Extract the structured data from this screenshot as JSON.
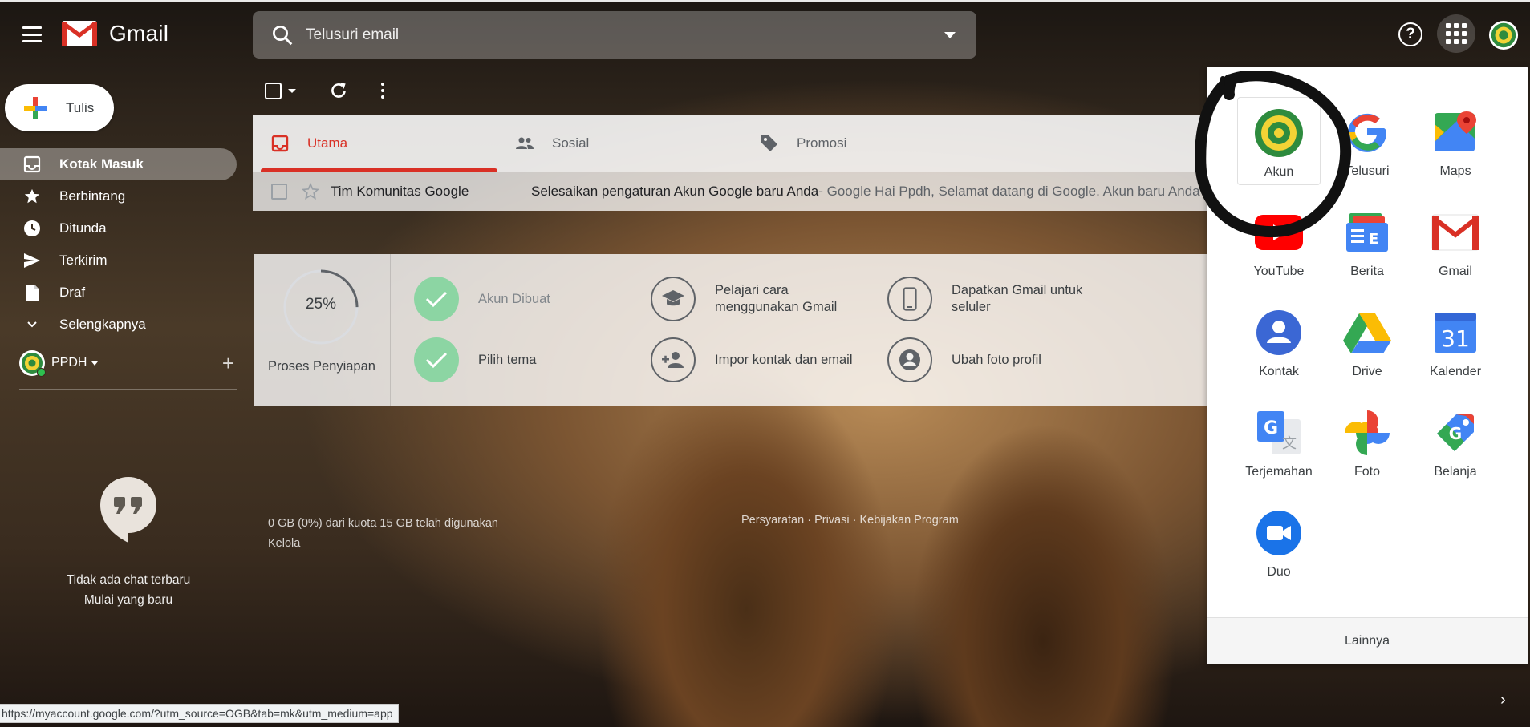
{
  "header": {
    "app_name": "Gmail",
    "search_placeholder": "Telusuri email"
  },
  "compose": {
    "label": "Tulis"
  },
  "nav": {
    "items": [
      {
        "label": "Kotak Masuk"
      },
      {
        "label": "Berbintang"
      },
      {
        "label": "Ditunda"
      },
      {
        "label": "Terkirim"
      },
      {
        "label": "Draf"
      },
      {
        "label": "Selengkapnya"
      }
    ]
  },
  "account": {
    "name": "PPDH"
  },
  "chat": {
    "empty_text": "Tidak ada chat terbaru",
    "start_text": "Mulai yang baru"
  },
  "tabs": [
    {
      "label": "Utama"
    },
    {
      "label": "Sosial"
    },
    {
      "label": "Promosi"
    }
  ],
  "email": {
    "sender": "Tim Komunitas Google",
    "subject": "Selesaikan pengaturan Akun Google baru Anda",
    "snippet": " - Google Hai Ppdh, Selamat datang di Google. Akun baru Anda"
  },
  "setup": {
    "percent": "25%",
    "percent_value": 0.25,
    "label": "Proses Penyiapan",
    "tasks": [
      {
        "label": "Akun Dibuat",
        "done": true
      },
      {
        "label": "Pelajari cara menggunakan Gmail",
        "done": false
      },
      {
        "label": "Dapatkan Gmail untuk seluler",
        "done": false
      },
      {
        "label": "Pilih tema",
        "done": true
      },
      {
        "label": "Impor kontak dan email",
        "done": false
      },
      {
        "label": "Ubah foto profil",
        "done": false
      }
    ]
  },
  "footer": {
    "storage": "0 GB (0%) dari kuota 15 GB telah digunakan",
    "manage": "Kelola",
    "links": "Persyaratan · Privasi · Kebijakan Program"
  },
  "status_url": "https://myaccount.google.com/?utm_source=OGB&tab=mk&utm_medium=app",
  "apps": {
    "items": [
      {
        "label": "Akun",
        "icon": "account-icon"
      },
      {
        "label": "Telusuri",
        "icon": "google-search-icon"
      },
      {
        "label": "Maps",
        "icon": "maps-icon"
      },
      {
        "label": "YouTube",
        "icon": "youtube-icon"
      },
      {
        "label": "Berita",
        "icon": "news-icon"
      },
      {
        "label": "Gmail",
        "icon": "gmail-icon"
      },
      {
        "label": "Kontak",
        "icon": "contacts-icon"
      },
      {
        "label": "Drive",
        "icon": "drive-icon"
      },
      {
        "label": "Kalender",
        "icon": "calendar-icon"
      },
      {
        "label": "Terjemahan",
        "icon": "translate-icon"
      },
      {
        "label": "Foto",
        "icon": "photos-icon"
      },
      {
        "label": "Belanja",
        "icon": "shopping-icon"
      },
      {
        "label": "Duo",
        "icon": "duo-icon"
      }
    ],
    "calendar_day": "31",
    "more_label": "Lainnya"
  },
  "colors": {
    "accent_red": "#d93025",
    "done_green": "#8cd5a3"
  }
}
